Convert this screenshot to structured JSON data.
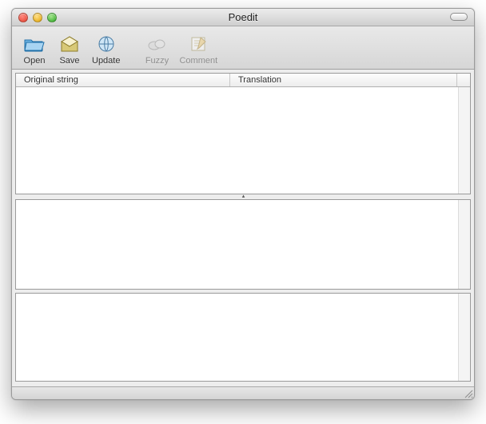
{
  "window": {
    "title": "Poedit"
  },
  "toolbar": {
    "open": {
      "label": "Open"
    },
    "save": {
      "label": "Save"
    },
    "update": {
      "label": "Update"
    },
    "fuzzy": {
      "label": "Fuzzy"
    },
    "comment": {
      "label": "Comment"
    }
  },
  "columns": {
    "original": "Original string",
    "translation": "Translation"
  },
  "editor": {
    "source_value": "",
    "translation_value": ""
  },
  "status": {
    "text": ""
  }
}
